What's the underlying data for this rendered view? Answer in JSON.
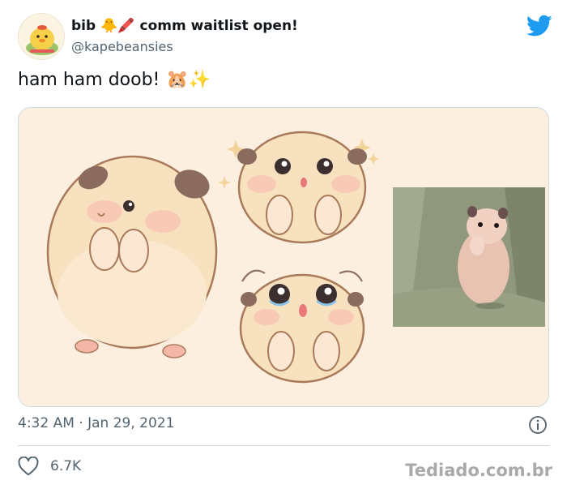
{
  "author": {
    "display_name": "bib",
    "name_emojis": "🐥🖍️",
    "name_suffix": "comm waitlist open!",
    "handle": "@kapebeansies",
    "avatar_icon": "duck-avatar-icon"
  },
  "tweet": {
    "text": "ham ham doob!",
    "emojis": "🐹✨",
    "timestamp": "4:32 AM · Jan 29, 2021",
    "likes": "6.7K"
  },
  "media": {
    "description_icons": [
      "hamster-illustration-icon",
      "hamster-photo-icon"
    ],
    "background_color": "#fcefe0"
  },
  "colors": {
    "twitter_blue": "#1d9bf0",
    "secondary_text": "#536471",
    "border": "#cfd9de"
  },
  "watermark": "Tediado.com.br"
}
